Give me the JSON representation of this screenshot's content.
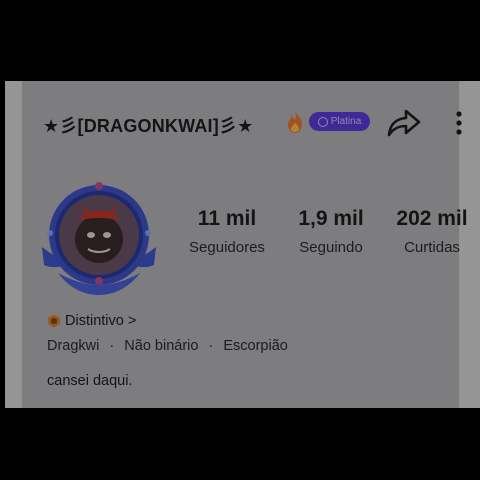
{
  "profile": {
    "username": "★彡[DRAGONKWAI]彡★",
    "badge_label": "Platina",
    "stats": [
      {
        "value": "11 mil",
        "label": "Seguidores"
      },
      {
        "value": "1,9 mil",
        "label": "Seguindo"
      },
      {
        "value": "202 mil",
        "label": "Curtidas"
      }
    ],
    "distinctive_label": "Distintivo",
    "distinctive_chevron": ">",
    "info": [
      "Dragkwi",
      "Não binário",
      "Escorpião"
    ],
    "info_separator": "·",
    "bio": "cansei daqui."
  },
  "icons": {
    "fire": "fire-icon",
    "share": "share-icon",
    "more": "more-vertical-icon",
    "distinctive": "hexagon-badge-icon"
  },
  "colors": {
    "accent": "#5b3bd8",
    "badge_orange": "#d9822b",
    "text": "#1d1d1f",
    "background": "#b4b4b8"
  }
}
